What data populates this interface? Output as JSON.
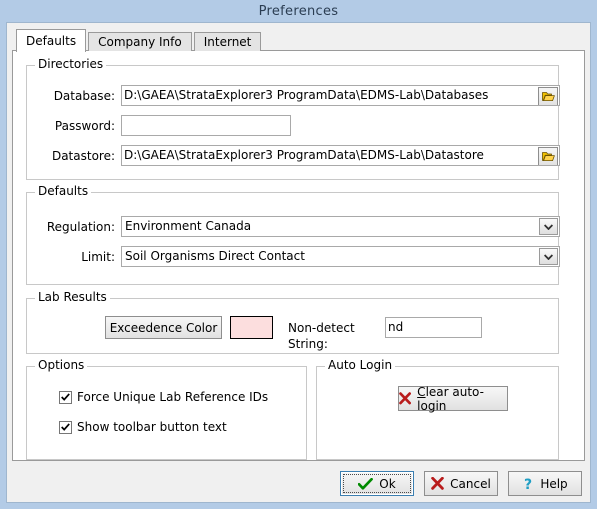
{
  "window": {
    "title": "Preferences",
    "titlebar_color": "#b3cbe6",
    "dialog_bg": "#f0f0f0",
    "page_bg": "#ffffff"
  },
  "tabs": [
    {
      "label": "Defaults",
      "active": true
    },
    {
      "label": "Company Info",
      "active": false
    },
    {
      "label": "Internet",
      "active": false
    }
  ],
  "directories": {
    "group_title": "Directories",
    "database_label": "Database:",
    "database_value": "D:\\GAEA\\StrataExplorer3 ProgramData\\EDMS-Lab\\Databases",
    "database_browse_icon": "folder-open-icon",
    "password_label": "Password:",
    "password_value": "",
    "password_placeholder": "",
    "datastore_label": "Datastore:",
    "datastore_value": "D:\\GAEA\\StrataExplorer3 ProgramData\\EDMS-Lab\\Datastore",
    "datastore_browse_icon": "folder-open-icon"
  },
  "defaults": {
    "group_title": "Defaults",
    "regulation_label": "Regulation:",
    "regulation_value": "Environment Canada",
    "limit_label": "Limit:",
    "limit_value": "Soil Organisms Direct Contact",
    "dropdown_icon": "chevron-down-icon"
  },
  "lab_results": {
    "group_title": "Lab Results",
    "exceedence_button_label": "Exceedence Color",
    "exceedence_color": "#fcdede",
    "nondetect_label": "Non-detect String:",
    "nondetect_value": "nd"
  },
  "options": {
    "group_title": "Options",
    "items": [
      {
        "label": "Force Unique Lab Reference IDs",
        "checked": true
      },
      {
        "label": "Show toolbar button text",
        "checked": true
      }
    ],
    "check_glyph": "check-icon"
  },
  "auto_login": {
    "group_title": "Auto Login",
    "button_label_prefix": "C",
    "button_label_rest": "lear auto-login",
    "button_icon": "red-x-icon",
    "icon_color": "#b91c1c"
  },
  "footer": {
    "ok_label": "Ok",
    "ok_icon": "green-check-icon",
    "ok_icon_color": "#008a00",
    "ok_focused": true,
    "cancel_label": "Cancel",
    "cancel_icon": "red-x-icon",
    "cancel_icon_color": "#b91c1c",
    "help_label": "Help",
    "help_icon": "question-mark-icon",
    "help_icon_color": "#1f9ec4"
  }
}
